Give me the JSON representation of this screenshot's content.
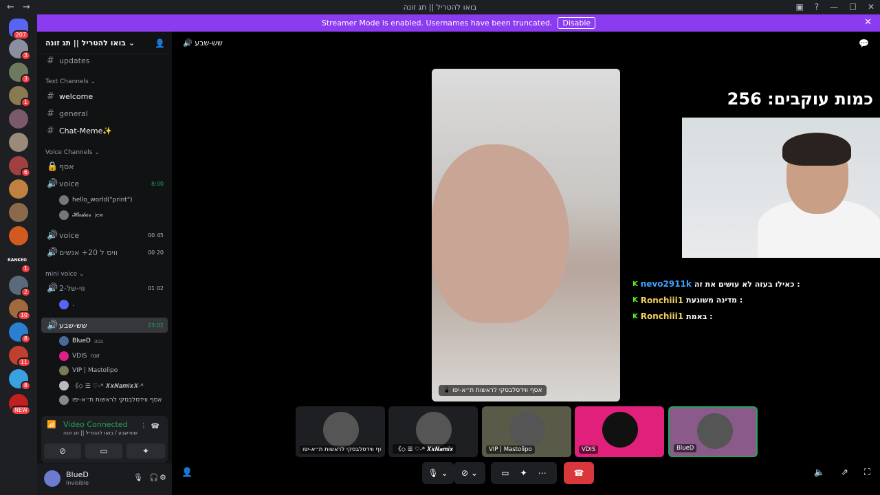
{
  "window": {
    "title": "בואו להטריל || תג זונה"
  },
  "banner": {
    "text": "Streamer Mode is enabled. Usernames have been truncated.",
    "button": "Disable"
  },
  "guilds": {
    "home_badge": "207",
    "items": [
      {
        "badge": "3"
      },
      {
        "badge": "3"
      },
      {
        "badge": "1"
      },
      {
        "badge": ""
      },
      {
        "badge": ""
      },
      {
        "badge": "6"
      },
      {
        "badge": ""
      },
      {
        "badge": ""
      },
      {
        "badge": ""
      },
      {
        "badge": "1",
        "label": "RANKED"
      },
      {
        "badge": "2"
      },
      {
        "badge": "10"
      },
      {
        "badge": "8"
      },
      {
        "badge": "11"
      },
      {
        "badge": "8"
      },
      {
        "badge": "NEW"
      }
    ]
  },
  "server": {
    "name": "בואו להטריל || תג זונה"
  },
  "channels": {
    "updates": "updates",
    "text_category": "Text Channels",
    "welcome": "welcome",
    "general": "general",
    "chat_meme": "Chat-Meme✨",
    "voice_category": "Voice Channels",
    "asaf": "אסף",
    "voice1": {
      "name": "voice",
      "time": "8:00"
    },
    "voice1_users": [
      "hello_world(\"print\")",
      "𝓗𝓪𝓭𝓪𝓻"
    ],
    "voice1_tag": "jew",
    "voice2": {
      "name": "voice",
      "a": "00",
      "b": "45"
    },
    "voice3": {
      "name": "וויס ל 20+ אנשים",
      "a": "00",
      "b": "20"
    },
    "mini_category": "mini voice",
    "mini1": {
      "name": "ווי-של-2",
      "a": "01",
      "b": "02"
    },
    "mini1_user": ".",
    "active": {
      "name": "שש-שבע",
      "time": "23:02"
    },
    "active_users": [
      {
        "name": "BlueD",
        "tag": "נכה"
      },
      {
        "name": "VDIS",
        "tag": "זונה"
      },
      {
        "name": "VIP | Mastolipo",
        "tag": ""
      },
      {
        "name": "《◇ ☰ ♡-* 𝑿𝒙𝑵𝒂𝒎𝒊𝒙𝑿-*",
        "tag": ""
      },
      {
        "name": "אסף ווידסלבסקי לראשות ת״א-יפו",
        "tag": ""
      }
    ]
  },
  "voice_panel": {
    "status": "Video Connected",
    "location": "שש-שבע / בואו להטריל || תג זונה"
  },
  "user": {
    "name": "BlueD",
    "status": "Invisible"
  },
  "stage": {
    "channel": "שש-שבע",
    "main_label": "אסף ווידסלבסקי לראשות ת״א-יפו"
  },
  "overlay": {
    "followers": "כמות עוקבים: 256",
    "chat": [
      {
        "user": "nevo2911k",
        "msg": "כאילו בעזה לא עושים את זה :",
        "color": "#3ba3ff"
      },
      {
        "user": "Ronchiii1",
        "msg": "מדינה משוגעת :",
        "color": "#f0d060"
      },
      {
        "user": "Ronchiii1",
        "msg": "באמת :",
        "color": "#f0d060"
      }
    ]
  },
  "tiles": [
    {
      "label": "אסף ווידסלבסקי לראשות ת״א-יפו"
    },
    {
      "label": "《◇ ☰ ♡-* 𝑿𝒙𝑵𝒂𝒎𝒊𝒙"
    },
    {
      "label": "VIP | Mastolipo"
    },
    {
      "label": "VDIS"
    },
    {
      "label": "BlueD"
    }
  ]
}
